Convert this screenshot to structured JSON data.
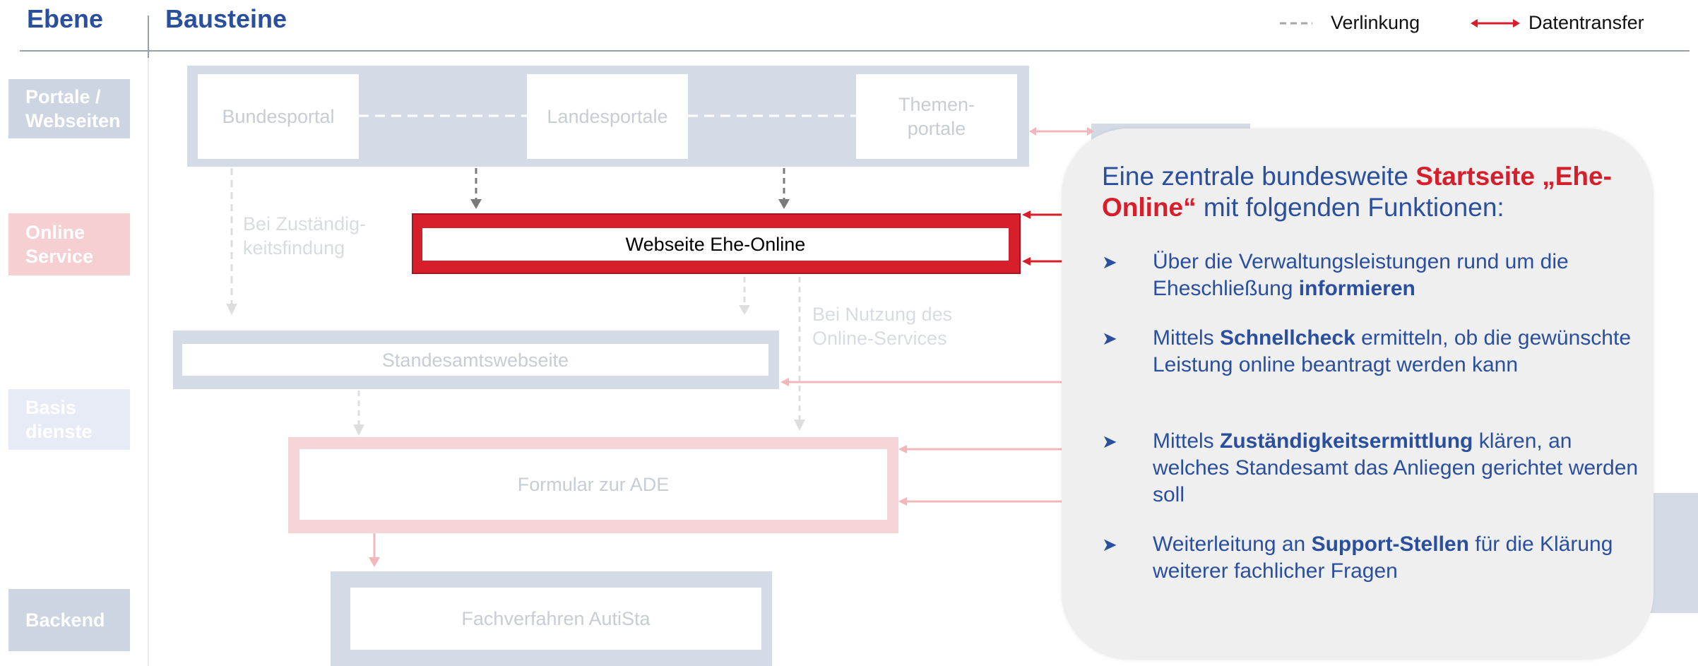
{
  "header": {
    "ebene": "Ebene",
    "bausteine": "Bausteine"
  },
  "legend": {
    "link_label": "Verlinkung",
    "transfer_label": "Datentransfer"
  },
  "levels": {
    "portale": "Portale / Webseiten",
    "online": "Online Service",
    "basis": "Basis dienste",
    "backend": "Backend"
  },
  "boxes": {
    "bundesportal": "Bundesportal",
    "landesportale": "Landesportale",
    "themenportale": "Themen-portale",
    "webseite": "Webseite Ehe-Online",
    "standesamt": "Standesamtswebseite",
    "formular": "Formular zur ADE",
    "fachverfahren": "Fachverfahren AutiSta"
  },
  "annotations": {
    "zustaendig": "Bei Zuständig-keitsfindung",
    "nutzung": "Bei Nutzung des Online-Services"
  },
  "callout": {
    "title_prefix": "Eine zentrale bundesweite ",
    "title_highlight": "Startseite „Ehe-Online“",
    "title_suffix": " mit folgenden Funktionen:",
    "bullets": [
      {
        "pre": "Über die Verwaltungsleistungen rund um die Eheschließung ",
        "bold": "informieren",
        "post": ""
      },
      {
        "pre": "Mittels ",
        "bold": "Schnellcheck",
        "post": " ermitteln, ob die gewünschte Leistung online beantragt werden kann"
      },
      {
        "pre": "Mittels ",
        "bold": "Zuständigkeitsermittlung",
        "post": " klären, an welches Standesamt das Anliegen gerichtet werden soll"
      },
      {
        "pre": "Weiterleitung an ",
        "bold": "Support-Stellen",
        "post": " für die Klärung weiterer fachlicher Fragen"
      }
    ]
  },
  "colors": {
    "blue": "#2a4f9e",
    "red": "#d61f2b",
    "faded_blue": "#d2d9e6",
    "faded_red": "#f3d0d2"
  }
}
